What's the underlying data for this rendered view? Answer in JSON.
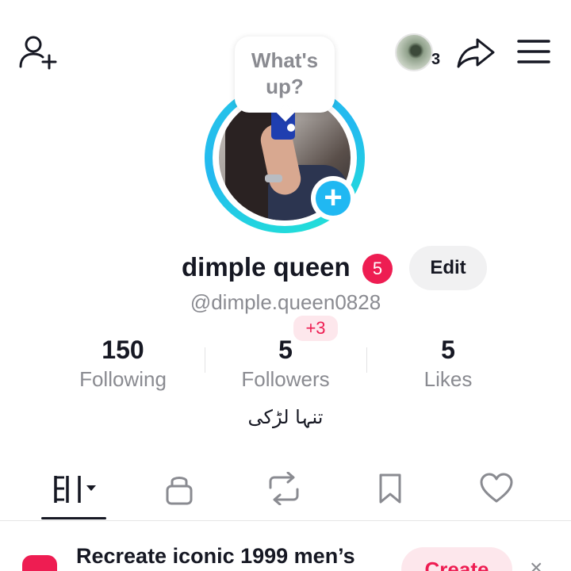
{
  "topbar": {
    "friend_count": "3"
  },
  "bubble": {
    "line1": "What's",
    "line2": "up?"
  },
  "profile": {
    "name": "dimple queen",
    "name_badge": "5",
    "edit_label": "Edit",
    "handle": "@dimple.queen0828",
    "bio": "تنہا لڑکی"
  },
  "stats": {
    "following": {
      "value": "150",
      "label": "Following"
    },
    "followers": {
      "value": "5",
      "label": "Followers",
      "delta": "+3"
    },
    "likes": {
      "value": "5",
      "label": "Likes"
    }
  },
  "tabs": [
    {
      "icon": "videos-grid-icon",
      "active": true
    },
    {
      "icon": "lock-icon",
      "active": false
    },
    {
      "icon": "repost-icon",
      "active": false
    },
    {
      "icon": "bookmark-icon",
      "active": false
    },
    {
      "icon": "heart-icon",
      "active": false
    }
  ],
  "promo": {
    "text": "Recreate iconic 1999 men’s",
    "button": "Create"
  },
  "colors": {
    "accent": "#ee1d52",
    "ring": "#20b8f2",
    "muted": "#8a8b91"
  }
}
